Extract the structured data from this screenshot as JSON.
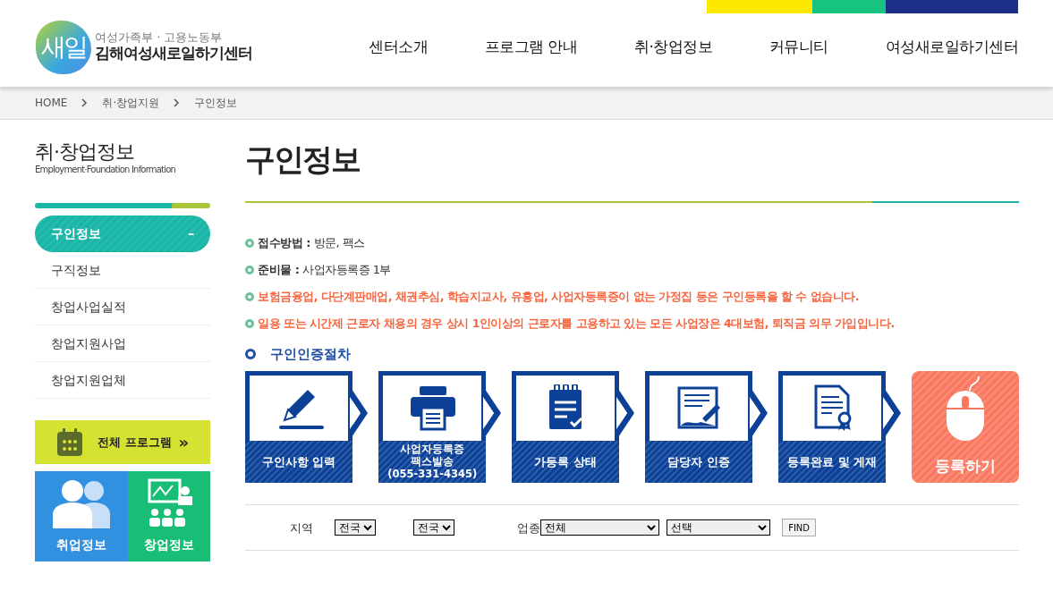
{
  "header": {
    "logo": {
      "ministry": "여성가족부 · 고용노동부",
      "name": "김해여성새로일하기센터",
      "mark": "새일"
    },
    "nav": [
      "센터소개",
      "프로그램 안내",
      "취·창업정보",
      "커뮤니티",
      "여성새로일하기센터"
    ]
  },
  "breadcrumb": [
    "HOME",
    "취·창업지원",
    "구인정보"
  ],
  "sidebar": {
    "title": "취·창업정보",
    "subtitle": "Employment·Foundation Information",
    "items": [
      {
        "label": "구인정보",
        "selected": true,
        "toggle": "–"
      },
      {
        "label": "구직정보",
        "selected": false
      },
      {
        "label": "창업사업실적",
        "selected": false
      },
      {
        "label": "창업지원사업",
        "selected": false
      },
      {
        "label": "창업지원업체",
        "selected": false
      }
    ],
    "program_button": {
      "label": "전체 프로그램",
      "arrow": "»"
    },
    "quick_links": [
      {
        "label": "취업정보",
        "kind": "job"
      },
      {
        "label": "창업정보",
        "kind": "startup"
      }
    ]
  },
  "page_title": "구인정보",
  "notes": [
    {
      "kind": "info",
      "text": "**접수방법 :** 방문, 팩스"
    },
    {
      "kind": "info",
      "text": "**준비물 :** 사업자등록증 1부"
    },
    {
      "kind": "warning",
      "text": "보험금융업, 다단계판매업, 채권추심, 학습지교사, 유흥업, 사업자등록증이 없는 가정집 등은 구인등록을 할 수 없습니다."
    },
    {
      "kind": "warning",
      "text": "일용 또는 시간제 근로자 채용의 경우 상시 1인이상의 근로자를 고용하고 있는 모든 사업장은 4대보험, 퇴직금 의무 가입입니다."
    }
  ],
  "procedure": {
    "title": "구인인증절차",
    "steps": [
      {
        "kind": "pencil",
        "lines": [
          "구인사항 입력"
        ]
      },
      {
        "kind": "printer",
        "lines": [
          "사업자등록증",
          "팩스발송",
          "(055-331-4345)"
        ]
      },
      {
        "kind": "clipboard",
        "lines": [
          "가등록 상태"
        ]
      },
      {
        "kind": "document",
        "lines": [
          "담당자 인증"
        ]
      },
      {
        "kind": "certificate",
        "lines": [
          "등록완료 및 게재"
        ]
      }
    ],
    "register_button": "등록하기"
  },
  "filter": {
    "region_label": "지역",
    "region_selects": [
      "전국",
      "전국"
    ],
    "industry_label": "업종",
    "industry_selects": [
      "전체",
      "선택"
    ],
    "find_button": "FIND"
  }
}
